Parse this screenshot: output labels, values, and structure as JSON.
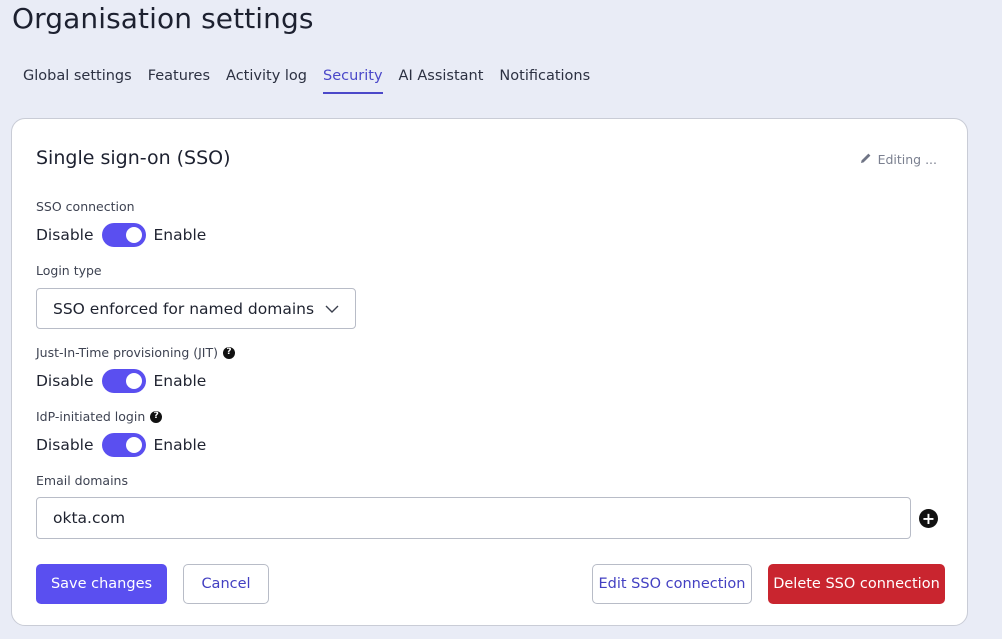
{
  "page": {
    "title": "Organisation settings"
  },
  "tabs": [
    {
      "label": "Global settings",
      "active": false
    },
    {
      "label": "Features",
      "active": false
    },
    {
      "label": "Activity log",
      "active": false
    },
    {
      "label": "Security",
      "active": true
    },
    {
      "label": "AI Assistant",
      "active": false
    },
    {
      "label": "Notifications",
      "active": false
    }
  ],
  "sso": {
    "title": "Single sign-on (SSO)",
    "editing_label": "Editing ...",
    "connection": {
      "label": "SSO connection",
      "off_label": "Disable",
      "on_label": "Enable",
      "enabled": true
    },
    "login_type": {
      "label": "Login type",
      "selected": "SSO enforced for named domains"
    },
    "jit": {
      "label": "Just-In-Time provisioning (JIT)",
      "off_label": "Disable",
      "on_label": "Enable",
      "enabled": true
    },
    "idp": {
      "label": "IdP-initiated login",
      "off_label": "Disable",
      "on_label": "Enable",
      "enabled": true
    },
    "email_domains": {
      "label": "Email domains",
      "value": "okta.com"
    },
    "buttons": {
      "save": "Save changes",
      "cancel": "Cancel",
      "edit": "Edit SSO connection",
      "delete": "Delete SSO connection"
    }
  },
  "colors": {
    "accent": "#5a4ff0",
    "danger": "#c9252f",
    "background": "#e9ecf6"
  }
}
